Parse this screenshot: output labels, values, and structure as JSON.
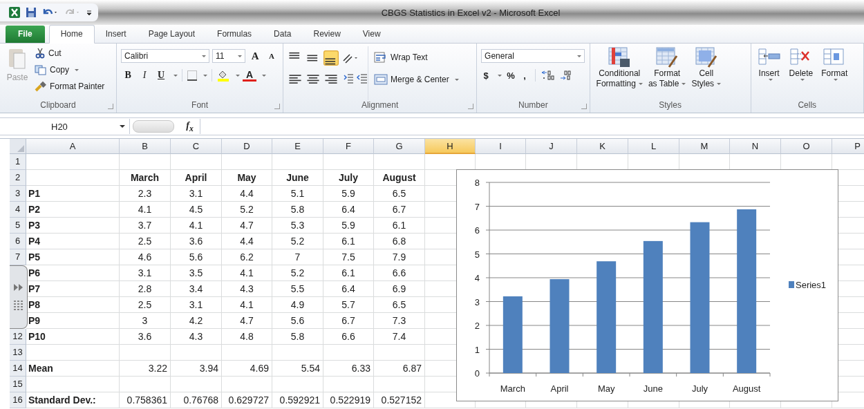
{
  "window": {
    "title": "CBGS Statistics in Excel v2  -  Microsoft Excel"
  },
  "tabs": [
    {
      "label": "File",
      "kind": "file",
      "selected": false
    },
    {
      "label": "Home",
      "kind": "tab",
      "selected": true
    },
    {
      "label": "Insert",
      "kind": "tab",
      "selected": false
    },
    {
      "label": "Page Layout",
      "kind": "tab",
      "selected": false
    },
    {
      "label": "Formulas",
      "kind": "tab",
      "selected": false
    },
    {
      "label": "Data",
      "kind": "tab",
      "selected": false
    },
    {
      "label": "Review",
      "kind": "tab",
      "selected": false
    },
    {
      "label": "View",
      "kind": "tab",
      "selected": false
    }
  ],
  "ribbon": {
    "clipboard": {
      "label": "Clipboard",
      "paste": {
        "label": "Paste",
        "disabled": true
      },
      "cut": "Cut",
      "copy": "Copy",
      "format_painter": "Format Painter"
    },
    "font": {
      "label": "Font",
      "font_name": "Calibri",
      "font_size": "11",
      "grow": "A",
      "shrink": "A",
      "bold": "B",
      "italic": "I",
      "underline": "U",
      "font_color": "A"
    },
    "alignment": {
      "label": "Alignment",
      "align_buttons": [
        {
          "kind": "top",
          "selected": false
        },
        {
          "kind": "middle",
          "selected": false
        },
        {
          "kind": "bottom",
          "selected": true
        },
        {
          "kind": "left",
          "selected": false
        },
        {
          "kind": "center",
          "selected": false
        },
        {
          "kind": "right",
          "selected": false
        }
      ],
      "wrap_text": "Wrap Text",
      "merge_center": "Merge & Center"
    },
    "number": {
      "label": "Number",
      "format": "General",
      "currency": "$",
      "percent": "%",
      "comma": ","
    },
    "styles": {
      "label": "Styles",
      "buttons": [
        {
          "kind": "conditional",
          "lines": [
            "Conditional",
            "Formatting"
          ]
        },
        {
          "kind": "table",
          "lines": [
            "Format",
            "as Table"
          ]
        },
        {
          "kind": "cell",
          "lines": [
            "Cell",
            "Styles"
          ]
        }
      ]
    },
    "cells": {
      "label": "Cells",
      "buttons": [
        {
          "kind": "insert",
          "label": "Insert"
        },
        {
          "kind": "delete",
          "label": "Delete"
        },
        {
          "kind": "format",
          "label": "Format"
        }
      ]
    }
  },
  "formula_bar": {
    "name_box": "H20",
    "function_label": "f$_{x}$"
  },
  "sheet": {
    "columns": [
      {
        "label": "A",
        "selected": false
      },
      {
        "label": "B",
        "selected": false
      },
      {
        "label": "C",
        "selected": false
      },
      {
        "label": "D",
        "selected": false
      },
      {
        "label": "E",
        "selected": false
      },
      {
        "label": "F",
        "selected": false
      },
      {
        "label": "G",
        "selected": false
      },
      {
        "label": "H",
        "selected": true
      },
      {
        "label": "I",
        "selected": false
      },
      {
        "label": "J",
        "selected": false
      },
      {
        "label": "K",
        "selected": false
      },
      {
        "label": "L",
        "selected": false
      },
      {
        "label": "M",
        "selected": false
      },
      {
        "label": "N",
        "selected": false
      },
      {
        "label": "O",
        "selected": false
      },
      {
        "label": "P",
        "selected": false
      }
    ],
    "rows": [
      {
        "number": "1",
        "cells": []
      },
      {
        "number": "2",
        "kind": "header",
        "cells": [
          "",
          "March",
          "April",
          "May",
          "June",
          "July",
          "August"
        ]
      },
      {
        "number": "3",
        "kind": "data",
        "cells": [
          "P1",
          "2.3",
          "3.1",
          "4.4",
          "5.1",
          "5.9",
          "6.5"
        ]
      },
      {
        "number": "4",
        "kind": "data",
        "cells": [
          "P2",
          "4.1",
          "4.5",
          "5.2",
          "5.8",
          "6.4",
          "6.7"
        ]
      },
      {
        "number": "5",
        "kind": "data",
        "cells": [
          "P3",
          "3.7",
          "4.1",
          "4.7",
          "5.3",
          "5.9",
          "6.1"
        ]
      },
      {
        "number": "6",
        "kind": "data",
        "cells": [
          "P4",
          "2.5",
          "3.6",
          "4.4",
          "5.2",
          "6.1",
          "6.8"
        ]
      },
      {
        "number": "7",
        "kind": "data",
        "cells": [
          "P5",
          "4.6",
          "5.6",
          "6.2",
          "7",
          "7.5",
          "7.9"
        ]
      },
      {
        "kind": "data",
        "cells": [
          "P6",
          "3.1",
          "3.5",
          "4.1",
          "5.2",
          "6.1",
          "6.6"
        ]
      },
      {
        "kind": "data",
        "cells": [
          "P7",
          "2.8",
          "3.4",
          "4.3",
          "5.5",
          "6.4",
          "6.9"
        ]
      },
      {
        "kind": "data",
        "cells": [
          "P8",
          "2.5",
          "3.1",
          "4.1",
          "4.9",
          "5.7",
          "6.5"
        ]
      },
      {
        "kind": "data",
        "cells": [
          "P9",
          "3",
          "4.2",
          "4.7",
          "5.6",
          "6.7",
          "7.3"
        ]
      },
      {
        "number": "12",
        "kind": "data",
        "cells": [
          "P10",
          "3.6",
          "4.3",
          "4.8",
          "5.8",
          "6.6",
          "7.4"
        ]
      },
      {
        "number": "13",
        "cells": []
      },
      {
        "number": "14",
        "kind": "summary",
        "cells": [
          "Mean",
          "3.22",
          "3.94",
          "4.69",
          "5.54",
          "6.33",
          "6.87"
        ]
      },
      {
        "number": "15",
        "cells": []
      },
      {
        "number": "16",
        "kind": "summary",
        "cells": [
          "Standard Dev.:",
          "0.758361",
          "0.76768",
          "0.629727",
          "0.592921",
          "0.522919",
          "0.527152"
        ]
      }
    ],
    "chart": {
      "chart_data": {
        "type": "bar",
        "categories": [
          "March",
          "April",
          "May",
          "June",
          "July",
          "August"
        ],
        "series": [
          {
            "name": "Series1",
            "color": "#4f81bd",
            "values": [
              3.22,
              3.94,
              4.69,
              5.54,
              6.33,
              6.87
            ]
          }
        ],
        "ylim": [
          0,
          8
        ],
        "yticks": [
          0,
          1,
          2,
          3,
          4,
          5,
          6,
          7,
          8
        ],
        "grid": true
      }
    }
  }
}
